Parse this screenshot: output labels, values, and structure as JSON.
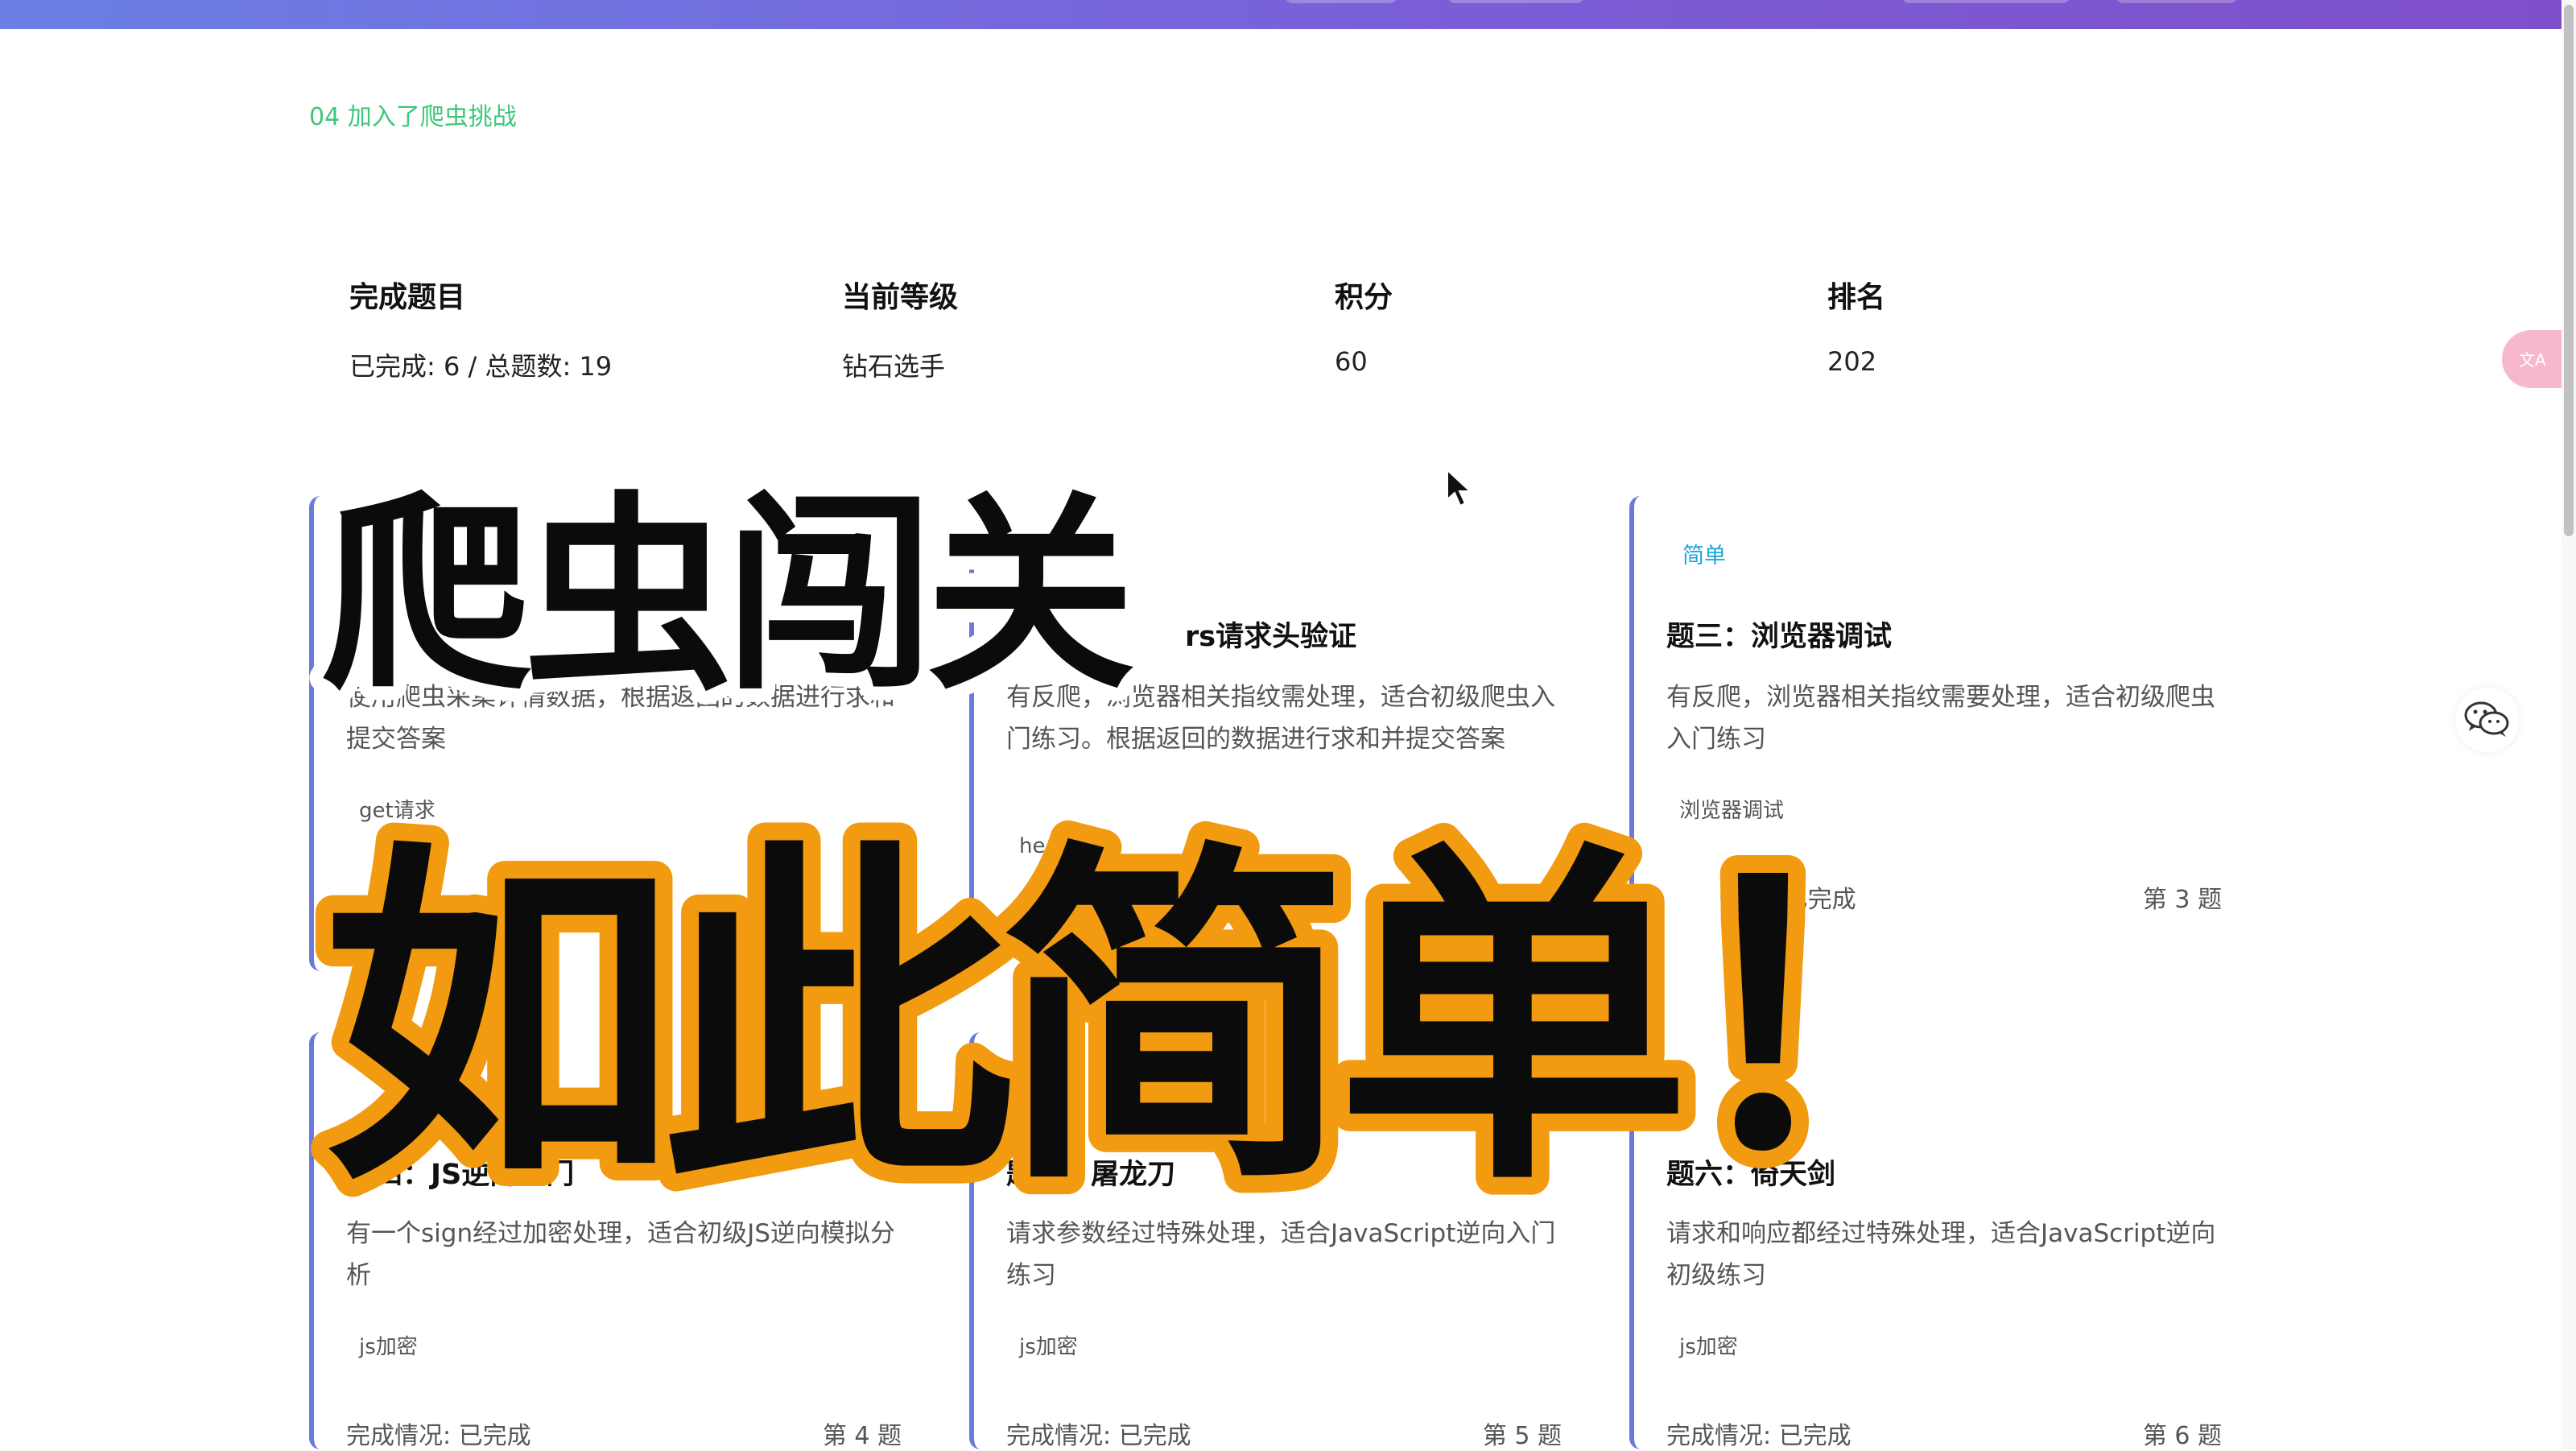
{
  "notice": "04 加入了爬虫挑战",
  "stats": [
    {
      "label": "完成题目",
      "value": "已完成: 6 / 总题数: 19"
    },
    {
      "label": "当前等级",
      "value": "钻石选手"
    },
    {
      "label": "积分",
      "value": "60"
    },
    {
      "label": "排名",
      "value": "202"
    }
  ],
  "cards": [
    {
      "tag": "",
      "title": "",
      "desc": "使用爬虫采集详情数据，根据返回的数据进行求和提交答案",
      "chip": "get请求",
      "status": "",
      "num": ""
    },
    {
      "tag": "",
      "title": "rs请求头验证",
      "desc": "有反爬，浏览器相关指纹需处理，适合初级爬虫入门练习。根据返回的数据进行求和并提交答案",
      "chip": "he",
      "status": "",
      "num": ""
    },
    {
      "tag": "简单",
      "title": "题三：浏览器调试",
      "desc": "有反爬，浏览器相关指纹需要处理，适合初级爬虫入门练习",
      "chip": "浏览器调试",
      "status": "情况: 已完成",
      "num": "第 3 题"
    },
    {
      "tag": "",
      "title": "题四：JS逆向入门",
      "desc": "有一个sign经过加密处理，适合初级JS逆向模拟分析",
      "chip": "js加密",
      "status": "完成情况: 已完成",
      "num": "第 4 题"
    },
    {
      "tag": "简",
      "title": "题五：屠龙刀",
      "desc": "请求参数经过特殊处理，适合JavaScript逆向入门练习",
      "chip": "js加密",
      "status": "完成情况: 已完成",
      "num": "第 5 题"
    },
    {
      "tag": "",
      "title": "题六：倚天剑",
      "desc": "请求和响应都经过特殊处理，适合JavaScript逆向初级练习",
      "chip": "js加密",
      "status": "完成情况: 已完成",
      "num": "第 6 题"
    }
  ],
  "overlay": {
    "line1": "爬虫闯关",
    "line2": "如此简单！"
  },
  "widgets": {
    "translate_label": "文A"
  },
  "colors": {
    "header_gradient_start": "#6b7fe6",
    "header_gradient_end": "#7e4fc9",
    "card_accent": "#6b7ad9",
    "notice_green": "#3ec77a",
    "overlay_outline": "#f29a10"
  }
}
